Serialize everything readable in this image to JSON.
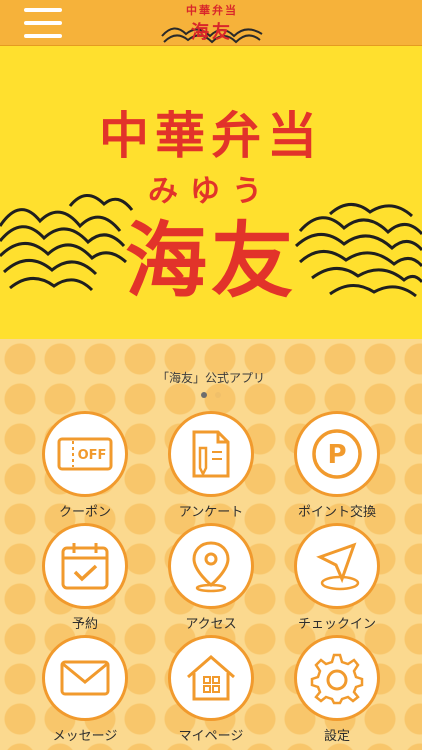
{
  "header": {
    "menu_icon": "hamburger-menu-icon",
    "logo_small_title": "中華弁当",
    "logo_small_name": "海友"
  },
  "banner": {
    "title": "中華弁当",
    "ruby": "みゆう",
    "name": "海友"
  },
  "main": {
    "caption": "「海友」公式アプリ",
    "pager_active_index": 0,
    "menu": [
      {
        "label": "クーポン",
        "icon": "coupon-icon",
        "badge": "OFF"
      },
      {
        "label": "アンケート",
        "icon": "survey-icon"
      },
      {
        "label": "ポイント交換",
        "icon": "points-icon",
        "badge": "P"
      },
      {
        "label": "予約",
        "icon": "calendar-icon"
      },
      {
        "label": "アクセス",
        "icon": "map-pin-icon"
      },
      {
        "label": "チェックイン",
        "icon": "checkin-icon"
      },
      {
        "label": "メッセージ",
        "icon": "mail-icon"
      },
      {
        "label": "マイページ",
        "icon": "house-icon"
      },
      {
        "label": "設定",
        "icon": "gear-icon"
      }
    ]
  },
  "colors": {
    "topbar": "#f6b23a",
    "banner_bg": "#ffe02e",
    "brand_red": "#e2332a",
    "accent_orange": "#f19a2d",
    "content_bg": "#fbd98f"
  }
}
